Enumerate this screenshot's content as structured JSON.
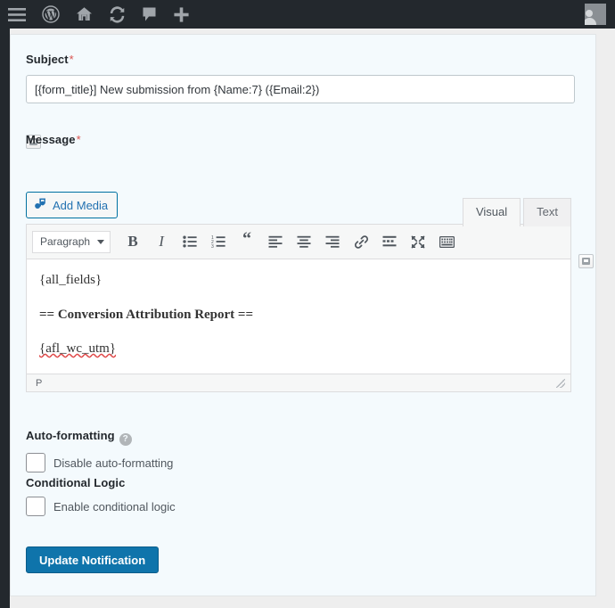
{
  "adminbar": {
    "items": [
      {
        "name": "menu-toggle-icon",
        "label": "Menu"
      },
      {
        "name": "wordpress-logo-icon",
        "label": "About WordPress"
      },
      {
        "name": "home-icon",
        "label": "Visit Site"
      },
      {
        "name": "updates-icon",
        "label": "Updates"
      },
      {
        "name": "comments-icon",
        "label": "Comments"
      },
      {
        "name": "new-content-icon",
        "label": "New"
      }
    ],
    "avatar_label": "My Account"
  },
  "subject": {
    "label": "Subject",
    "required_marker": "*",
    "value": "[{form_title}] New submission from {Name:7} ({Email:2})",
    "placeholder": "",
    "mergetag_label": "Insert merge tag"
  },
  "message": {
    "label": "Message",
    "required_marker": "*",
    "add_media_label": "Add Media",
    "mergetag_label": "Insert merge tag",
    "tabs": [
      {
        "label": "Visual",
        "active": true
      },
      {
        "label": "Text",
        "active": false
      }
    ],
    "toolbar": {
      "format_label": "Paragraph",
      "buttons": [
        {
          "name": "bold-icon",
          "label": "B"
        },
        {
          "name": "italic-icon",
          "label": "I"
        },
        {
          "name": "bulleted-list-icon",
          "label": "Bulleted list"
        },
        {
          "name": "numbered-list-icon",
          "label": "Numbered list"
        },
        {
          "name": "blockquote-icon",
          "label": "“"
        },
        {
          "name": "align-left-icon",
          "label": "Align left"
        },
        {
          "name": "align-center-icon",
          "label": "Align center"
        },
        {
          "name": "align-right-icon",
          "label": "Align right"
        },
        {
          "name": "insert-link-icon",
          "label": "Insert link"
        },
        {
          "name": "read-more-icon",
          "label": "Insert Read More tag"
        },
        {
          "name": "fullscreen-icon",
          "label": "Distraction-free writing mode"
        },
        {
          "name": "toolbar-toggle-icon",
          "label": "Toolbar Toggle"
        }
      ]
    },
    "content": {
      "line1": "{all_fields}",
      "line2": "== Conversion Attribution Report ==",
      "line3": "{afl_wc_utm}"
    },
    "status_path": "P"
  },
  "autoformatting": {
    "label": "Auto-formatting",
    "help_glyph": "?",
    "checkbox_label": "Disable auto-formatting",
    "checked": false
  },
  "conditional_logic": {
    "label": "Conditional Logic",
    "checkbox_label": "Enable conditional logic",
    "checked": false
  },
  "submit": {
    "label": "Update Notification"
  },
  "colors": {
    "adminbar_bg": "#23282d",
    "panel_bg": "#f4fafd",
    "accent_blue": "#0f74ab",
    "link_blue": "#2271b1",
    "required_red": "#d9534f",
    "spellcheck_red": "#e04b4b"
  }
}
